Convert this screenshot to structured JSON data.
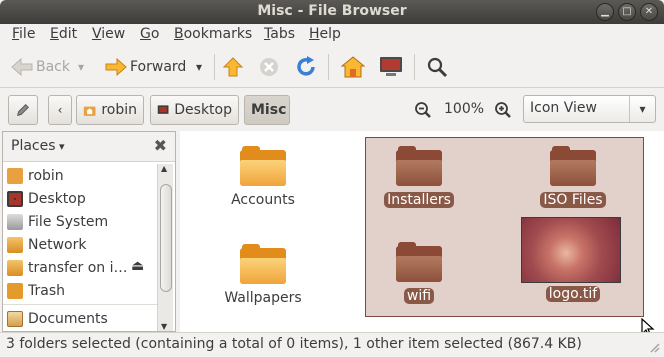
{
  "window": {
    "title": "Misc - File Browser"
  },
  "menubar": {
    "items": [
      {
        "label": "File",
        "mnemonic": "F",
        "rest": "ile"
      },
      {
        "label": "Edit",
        "mnemonic": "E",
        "rest": "dit"
      },
      {
        "label": "View",
        "mnemonic": "V",
        "rest": "iew"
      },
      {
        "label": "Go",
        "mnemonic": "G",
        "rest": "o"
      },
      {
        "label": "Bookmarks",
        "mnemonic": "B",
        "rest": "ookmarks"
      },
      {
        "label": "Tabs",
        "mnemonic": "T",
        "rest": "abs"
      },
      {
        "label": "Help",
        "mnemonic": "H",
        "rest": "elp"
      }
    ]
  },
  "toolbar": {
    "back_label": "Back",
    "forward_label": "Forward",
    "icons": [
      "back-arrow-icon",
      "forward-arrow-icon",
      "up-arrow-icon",
      "stop-icon",
      "reload-icon",
      "home-icon",
      "computer-icon",
      "search-icon"
    ]
  },
  "location": {
    "crumbs": [
      "robin",
      "Desktop",
      "Misc"
    ],
    "zoom": "100%",
    "view_mode": "Icon View"
  },
  "sidebar": {
    "header": "Places",
    "items": [
      {
        "label": "robin",
        "icon": "home-folder-icon"
      },
      {
        "label": "Desktop",
        "icon": "desktop-icon"
      },
      {
        "label": "File System",
        "icon": "drive-icon"
      },
      {
        "label": "Network",
        "icon": "network-icon"
      },
      {
        "label": "transfer on i…",
        "icon": "network-share-icon"
      },
      {
        "label": "Trash",
        "icon": "trash-icon"
      },
      {
        "label": "Documents",
        "icon": "documents-icon"
      }
    ]
  },
  "files": [
    {
      "name": "Accounts",
      "kind": "folder",
      "selected": false
    },
    {
      "name": "Wallpapers",
      "kind": "folder",
      "selected": false
    },
    {
      "name": "Installers",
      "kind": "folder",
      "selected": true
    },
    {
      "name": "ISO Files",
      "kind": "folder",
      "selected": true
    },
    {
      "name": "wifi",
      "kind": "folder",
      "selected": true
    },
    {
      "name": "logo.tif",
      "kind": "image",
      "selected": true
    }
  ],
  "status": {
    "text": "3 folders selected (containing a total of 0 items), 1 other item selected (867.4 KB)"
  },
  "colors": {
    "selection": "#8a5846",
    "folder": "#e28d1b",
    "accent": "#f07746"
  }
}
